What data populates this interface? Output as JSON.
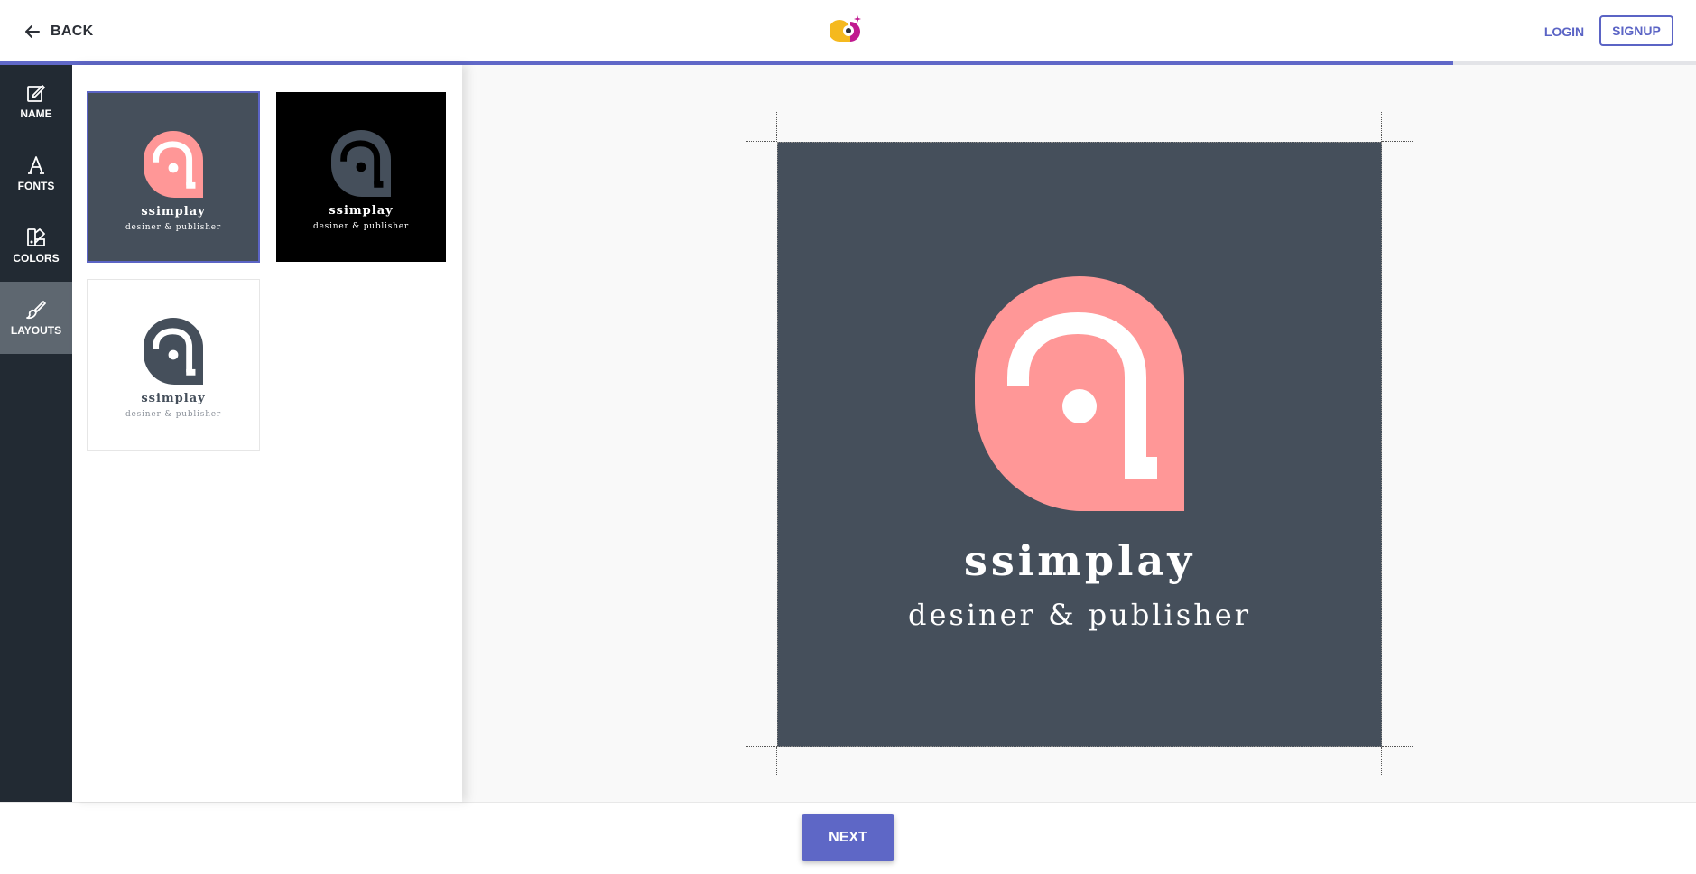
{
  "header": {
    "back_label": "BACK",
    "login_label": "LOGIN",
    "signup_label": "SIGNUP",
    "progress": 0.857
  },
  "rail": {
    "items": [
      {
        "label": "NAME",
        "icon": "edit-icon"
      },
      {
        "label": "FONTS",
        "icon": "font-icon"
      },
      {
        "label": "COLORS",
        "icon": "palette-icon"
      },
      {
        "label": "LAYOUTS",
        "icon": "brush-icon",
        "active": true
      }
    ]
  },
  "layouts": [
    {
      "name": "ssimplay",
      "tagline": "desiner & publisher",
      "background": "#454f5b",
      "icon_color": "#ff9797",
      "selected": true
    },
    {
      "name": "ssimplay",
      "tagline": "desiner & publisher",
      "background": "#000000",
      "icon_color": "#454f5b",
      "selected": false
    },
    {
      "name": "ssimplay",
      "tagline": "desiner & publisher",
      "background": "#ffffff",
      "icon_color": "#454f5b",
      "selected": false
    }
  ],
  "preview": {
    "name": "ssimplay",
    "tagline": "desiner & publisher",
    "background": "#454f5b",
    "icon_color": "#ff9797"
  },
  "footer": {
    "next_label": "NEXT"
  },
  "colors": {
    "accent": "#5e67c6",
    "rail_bg": "#222a33",
    "rail_active": "#5e6770"
  }
}
